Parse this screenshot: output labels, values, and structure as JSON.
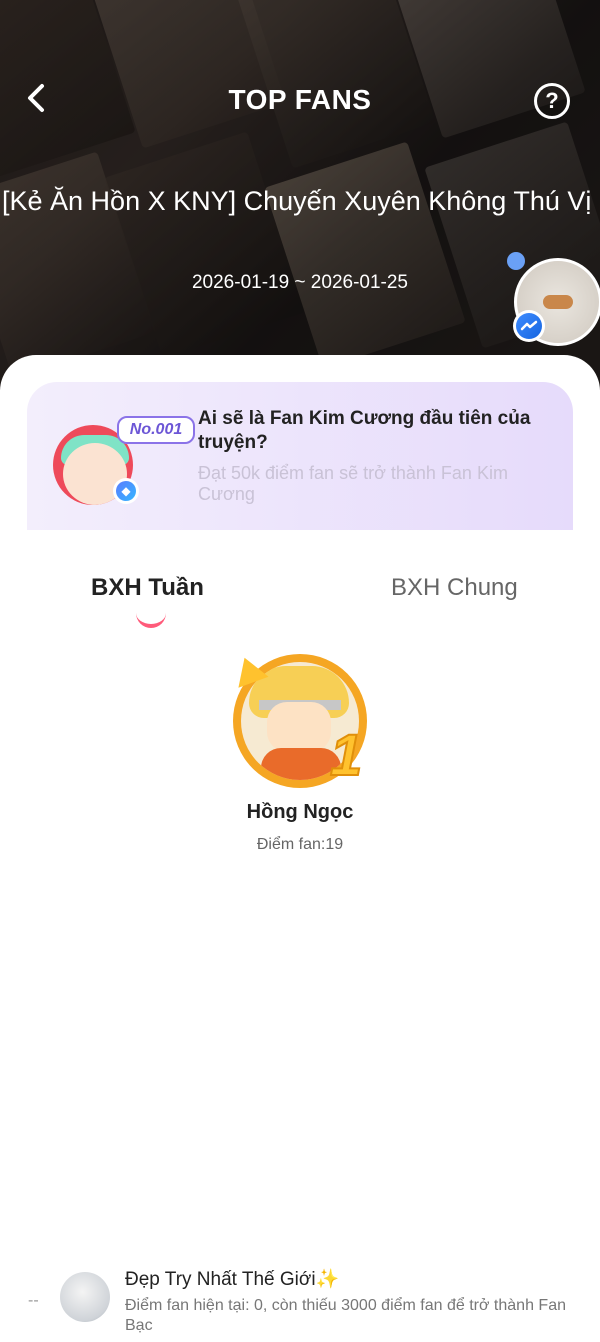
{
  "header": {
    "title": "TOP FANS",
    "help_label": "?",
    "story_title": "[Kẻ Ăn Hồn X KNY] Chuyến Xuyên Không Thú Vị",
    "date_range": "2026-01-19 ~ 2026-01-25"
  },
  "banner": {
    "badge": "No.001",
    "title": "Ai sẽ là Fan Kim Cương đầu tiên của truyện?",
    "subtitle": "Đạt 50k điểm fan sẽ trở thành Fan Kim Cương"
  },
  "tabs": [
    {
      "label": "BXH Tuần",
      "active": true
    },
    {
      "label": "BXH Chung",
      "active": false
    }
  ],
  "top_fan": {
    "rank": "1",
    "name": "Hồng Ngọc",
    "points_text": "Điểm fan:19"
  },
  "current_user": {
    "rank": "--",
    "name": "Đẹp Try Nhất Thế Giới✨",
    "info": "Điểm fan hiện tại: 0, còn thiếu 3000 điểm fan để trở thành Fan Bạc"
  },
  "colors": {
    "accent_pink": "#ff5b7a",
    "gold": "#f5a623",
    "banner_purple": "#e6dbfb"
  }
}
